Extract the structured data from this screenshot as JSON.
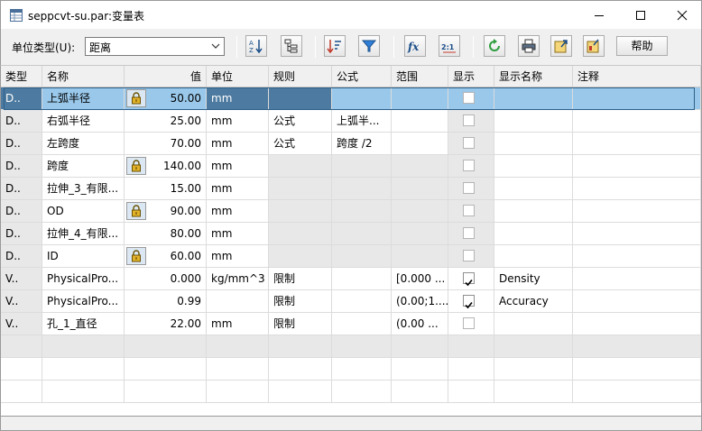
{
  "window": {
    "title": "seppcvt-su.par:变量表",
    "min_glyph": "—",
    "max_glyph": "☐",
    "close_glyph": "✕"
  },
  "toolbar": {
    "unit_type_label": "单位类型(U):",
    "unit_type_value": "距离",
    "help_label": "帮助",
    "buttons": [
      {
        "name": "sort-az-icon",
        "glyph": "A↓Z"
      },
      {
        "name": "tree-view-icon",
        "glyph": "⊞"
      },
      {
        "name": "sort-order-icon",
        "glyph": "⇅"
      },
      {
        "name": "filter-icon",
        "glyph": "▼"
      },
      {
        "name": "formula-fx-icon",
        "glyph": "fx"
      },
      {
        "name": "ratio-icon",
        "glyph": "2:1"
      },
      {
        "name": "refresh-icon",
        "glyph": "⟳"
      },
      {
        "name": "print-icon",
        "glyph": "⎙"
      },
      {
        "name": "export-icon",
        "glyph": "⇗"
      },
      {
        "name": "import-icon",
        "glyph": "⇘"
      }
    ]
  },
  "columns": [
    "类型",
    "名称",
    "值",
    "单位",
    "规则",
    "公式",
    "范围",
    "显示",
    "显示名称",
    "注释"
  ],
  "rows": [
    {
      "type": "D..",
      "name": "上弧半径",
      "locked": true,
      "value": "50.00",
      "unit": "mm",
      "rule": "",
      "formula": "",
      "range": "",
      "show": false,
      "display_name": "",
      "note": ""
    },
    {
      "type": "D..",
      "name": "右弧半径",
      "locked": false,
      "value": "25.00",
      "unit": "mm",
      "rule": "公式",
      "formula": "上弧半...",
      "range": "",
      "show": false,
      "display_name": "",
      "note": ""
    },
    {
      "type": "D..",
      "name": "左跨度",
      "locked": false,
      "value": "70.00",
      "unit": "mm",
      "rule": "公式",
      "formula": "跨度 /2",
      "range": "",
      "show": false,
      "display_name": "",
      "note": ""
    },
    {
      "type": "D..",
      "name": "跨度",
      "locked": true,
      "value": "140.00",
      "unit": "mm",
      "rule": "",
      "formula": "",
      "range": "",
      "show": false,
      "display_name": "",
      "note": ""
    },
    {
      "type": "D..",
      "name": "拉伸_3_有限...",
      "locked": false,
      "value": "15.00",
      "unit": "mm",
      "rule": "",
      "formula": "",
      "range": "",
      "show": false,
      "display_name": "",
      "note": ""
    },
    {
      "type": "D..",
      "name": "OD",
      "locked": true,
      "value": "90.00",
      "unit": "mm",
      "rule": "",
      "formula": "",
      "range": "",
      "show": false,
      "display_name": "",
      "note": ""
    },
    {
      "type": "D..",
      "name": "拉伸_4_有限...",
      "locked": false,
      "value": "80.00",
      "unit": "mm",
      "rule": "",
      "formula": "",
      "range": "",
      "show": false,
      "display_name": "",
      "note": ""
    },
    {
      "type": "D..",
      "name": "ID",
      "locked": true,
      "value": "60.00",
      "unit": "mm",
      "rule": "",
      "formula": "",
      "range": "",
      "show": false,
      "display_name": "",
      "note": ""
    },
    {
      "type": "V..",
      "name": "PhysicalPro...",
      "locked": false,
      "value": "0.000",
      "unit": "kg/mm^3",
      "rule": "限制",
      "formula": "",
      "range": "[0.000 ...",
      "show": true,
      "display_name": "Density",
      "note": ""
    },
    {
      "type": "V..",
      "name": "PhysicalPro...",
      "locked": false,
      "value": "0.99",
      "unit": "",
      "rule": "限制",
      "formula": "",
      "range": "(0.00;1....",
      "show": true,
      "display_name": "Accuracy",
      "note": ""
    },
    {
      "type": "V..",
      "name": "孔_1_直径",
      "locked": false,
      "value": "22.00",
      "unit": "mm",
      "rule": "限制",
      "formula": "",
      "range": "(0.00 ...",
      "show": false,
      "display_name": "",
      "note": ""
    }
  ]
}
